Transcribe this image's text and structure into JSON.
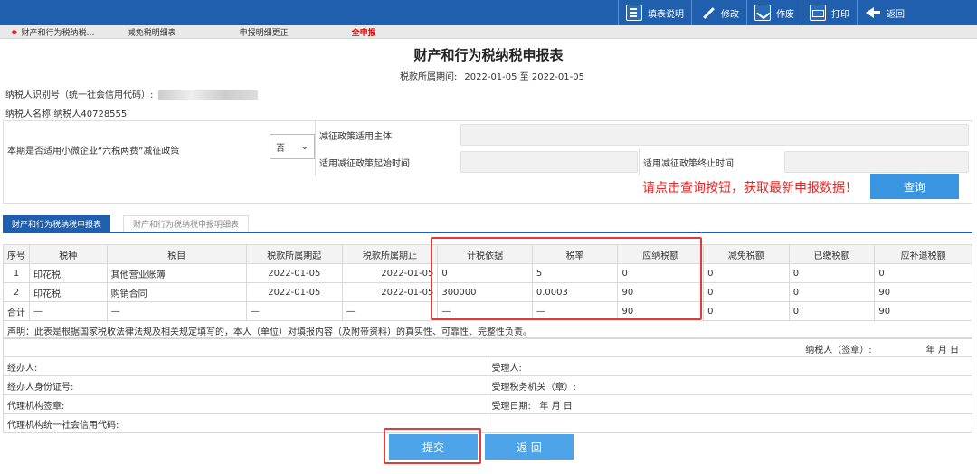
{
  "toolbar": {
    "fill_help": "填表说明",
    "modify": "修改",
    "void": "作废",
    "print": "打印",
    "back": "返回"
  },
  "nav_tabs": [
    "财产和行为税纳税…",
    "减免税明细表",
    "申报明细更正",
    "全申报"
  ],
  "form": {
    "title": "财产和行为税纳税申报表",
    "period_label": "税款所属期间:",
    "period_value": "2022-01-05 至 2022-01-05",
    "taxpayer_id_label": "纳税人识别号（统一社会信用代码）:",
    "taxpayer_name_label": "纳税人名称:",
    "taxpayer_name": "纳税人40728555"
  },
  "policy": {
    "question": "本期是否适用小微企业“六税两费”减征政策",
    "selected": "否",
    "subject_label": "减征政策适用主体",
    "start_label": "适用减征政策起始时间",
    "end_label": "适用减征政策终止时间",
    "hint": "请点击查询按钮，获取最新申报数据！",
    "query_btn": "查询"
  },
  "sub_tabs": [
    "财产和行为税纳税申报表",
    "财产和行为税纳税申报明细表"
  ],
  "table": {
    "headers": [
      "序号",
      "税种",
      "税目",
      "税款所属期起",
      "税款所属期止",
      "计税依据",
      "税率",
      "应纳税额",
      "减免税额",
      "已缴税额",
      "应补退税额"
    ],
    "rows": [
      [
        "1",
        "印花税",
        "其他营业账簿",
        "2022-01-05",
        "2022-01-05",
        "0",
        "5",
        "0",
        "0",
        "0",
        "0"
      ],
      [
        "2",
        "印花税",
        "购销合同",
        "2022-01-05",
        "2022-01-05",
        "300000",
        "0.0003",
        "90",
        "0",
        "0",
        "90"
      ],
      [
        "合计",
        "—",
        "—",
        "—",
        "—",
        "—",
        "—",
        "90",
        "0",
        "0",
        "90"
      ]
    ]
  },
  "declaration": "声明：此表是根据国家税收法律法规及相关规定填写的，本人（单位）对填报内容（及附带资料）的真实性、可靠性、完整性负责。",
  "signature": {
    "label": "纳税人（签章）:",
    "date": "年 月 日"
  },
  "footer": {
    "agent": "经办人:",
    "receiver": "受理人:",
    "agent_id": "经办人身份证号:",
    "tax_office": "受理税务机关（章）:",
    "agency_sign": "代理机构签章:",
    "accept_date": "受理日期:",
    "accept_date_val": "年 月 日",
    "agency_code": "代理机构统一社会信用代码:"
  },
  "buttons": {
    "submit": "提交",
    "return": "返 回"
  }
}
